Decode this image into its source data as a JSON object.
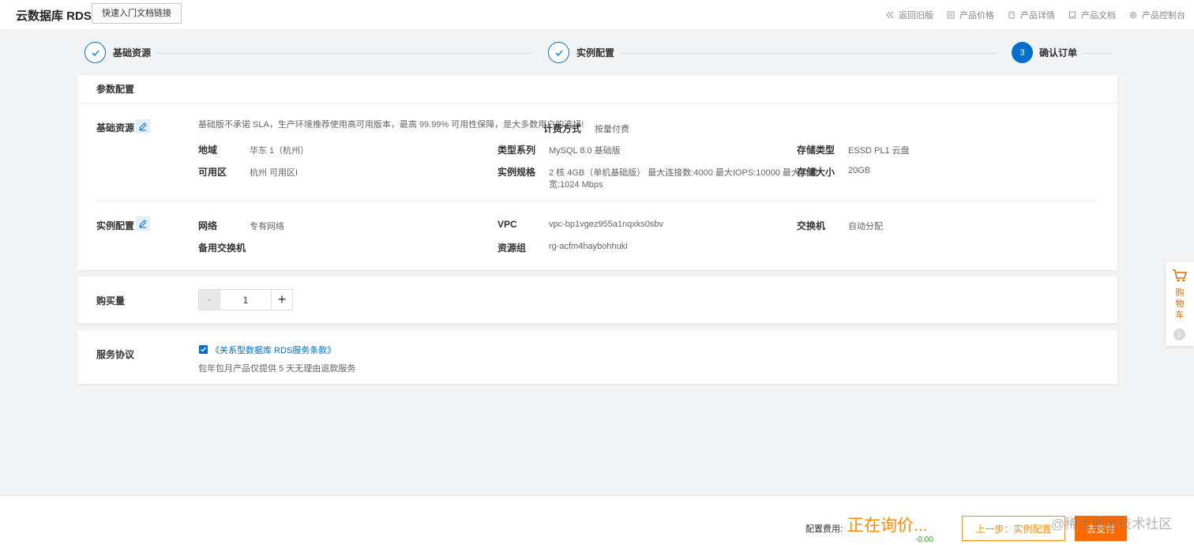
{
  "header": {
    "brand": "云数据库 RDS",
    "quick_link": "快速入门文档链接",
    "nav": [
      {
        "label": "返回旧版",
        "icon": "double-chevron-left-icon"
      },
      {
        "label": "产品价格",
        "icon": "price-list-icon"
      },
      {
        "label": "产品详情",
        "icon": "document-icon"
      },
      {
        "label": "产品文档",
        "icon": "doc-icon"
      },
      {
        "label": "产品控制台",
        "icon": "gear-icon"
      }
    ]
  },
  "steps": [
    {
      "label": "基础资源",
      "state": "done"
    },
    {
      "label": "实例配置",
      "state": "done"
    },
    {
      "number": "3",
      "label": "确认订单",
      "state": "active"
    }
  ],
  "params": {
    "title": "参数配置",
    "base": {
      "title": "基础资源",
      "notice": "基础版不承诺 SLA，生产环境推荐使用高可用版本，最高 99.99% 可用性保障，是大多数用户的选择!",
      "billing_label": "计费方式",
      "billing_value": "按量付费",
      "region_label": "地域",
      "region_value": "华东 1（杭州）",
      "series_label": "类型系列",
      "series_value": "MySQL 8.0 基础版",
      "storage_type_label": "存储类型",
      "storage_type_value": "ESSD PL1 云盘",
      "zone_label": "可用区",
      "zone_value": "杭州 可用区I",
      "spec_label": "实例规格",
      "spec_value_line1": "2 核 4GB（单机基础版）  最大连接数:4000 最大IOPS:10000 最大IO带",
      "spec_value_line2": "宽:1024 Mbps",
      "storage_size_label": "存储大小",
      "storage_size_value": "20GB"
    },
    "instance": {
      "title": "实例配置",
      "network_label": "网络",
      "network_value": "专有网络",
      "vpc_label": "VPC",
      "vpc_value": "vpc-bp1vgez955a1nqxks0sbv",
      "switch_label": "交换机",
      "switch_value": "自动分配",
      "backup_switch_label": "备用交换机",
      "resource_group_label": "资源组",
      "resource_group_value": "rg-acfm4haybohhuki"
    }
  },
  "quantity": {
    "label": "购买量",
    "value": "1",
    "minus": "-",
    "plus": "+"
  },
  "agreement": {
    "label": "服务协议",
    "link": "《关系型数据库 RDS服务条款》",
    "note": "包年包月产品仅提供 5 天无理由退款服务",
    "checked": true
  },
  "cart": {
    "text": "购物车",
    "count": "0"
  },
  "footer": {
    "fee_label": "配置费用:",
    "fee_status": "正在询价...",
    "discount": "-0.00",
    "prev_button": "上一步：实例配置",
    "pay_button": "去支付",
    "watermark": "@稀土掘金技术社区"
  },
  "colors": {
    "primary": "#0070cc",
    "orange": "#ff8a00",
    "pay": "#ff6a00",
    "discount": "#2aa515"
  }
}
